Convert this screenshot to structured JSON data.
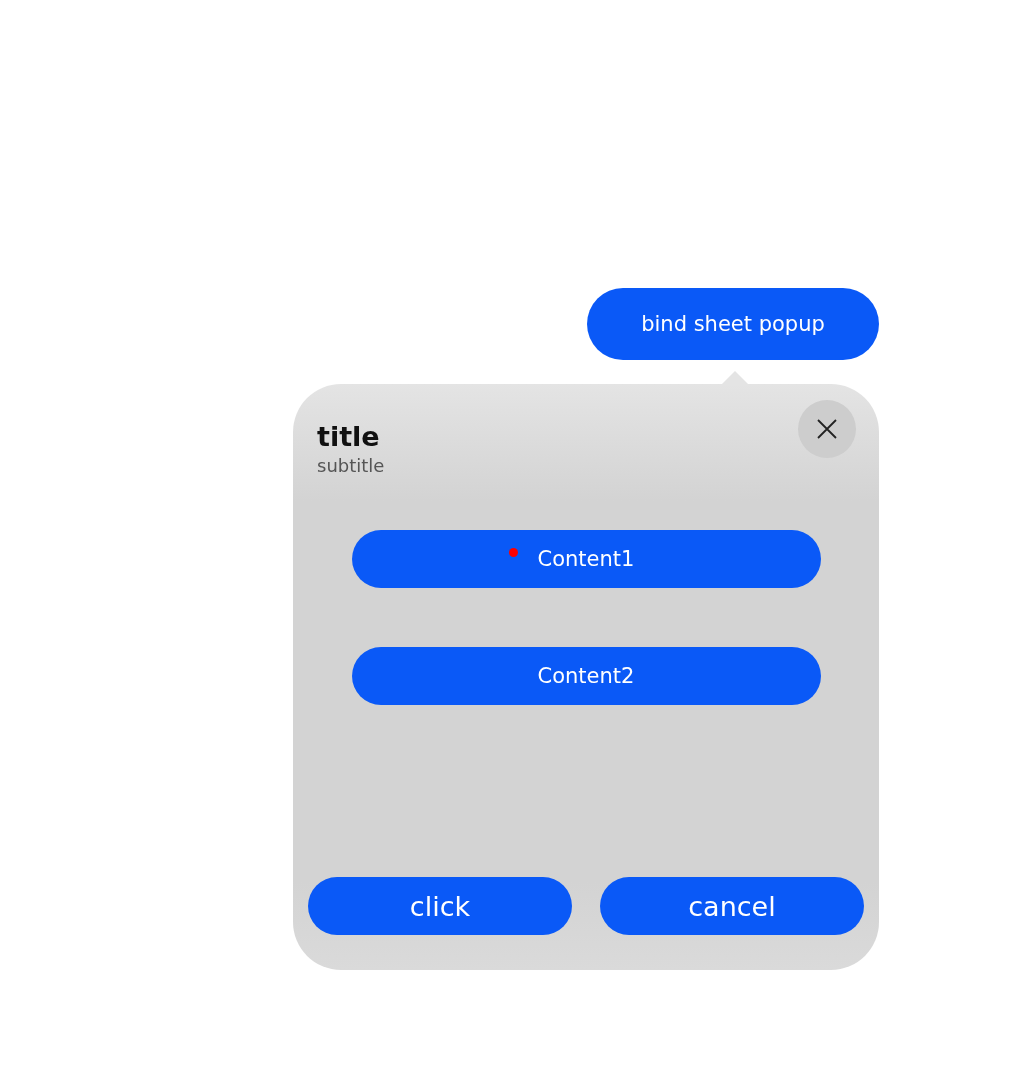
{
  "trigger_button": {
    "label": "bind sheet popup"
  },
  "sheet": {
    "title": "title",
    "subtitle": "subtitle",
    "content_buttons": [
      {
        "label": "Content1"
      },
      {
        "label": "Content2"
      }
    ],
    "footer_buttons": [
      {
        "label": "click"
      },
      {
        "label": "cancel"
      }
    ]
  }
}
